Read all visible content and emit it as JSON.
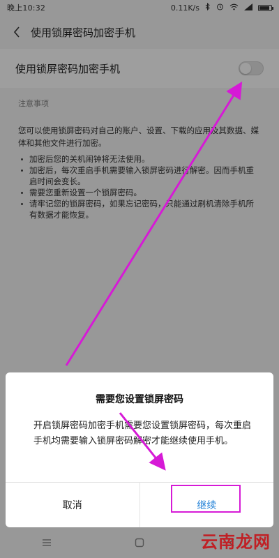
{
  "status_bar": {
    "time": "晚上10:32",
    "network_speed": "0.11K/s"
  },
  "header": {
    "title": "使用锁屏密码加密手机"
  },
  "setting": {
    "label": "使用锁屏密码加密手机",
    "enabled": false
  },
  "notes": {
    "heading": "注意事项",
    "intro": "您可以使用锁屏密码对自己的账户、设置、下载的应用及其数据、媒体和其他文件进行加密。",
    "items": [
      "加密后您的关机闹钟将无法使用。",
      "加密后，每次重启手机需要输入锁屏密码进行解密。因而手机重启时间会变长。",
      "需要您重新设置一个锁屏密码。",
      "请牢记您的锁屏密码，如果忘记密码，只能通过刷机清除手机所有数据才能恢复。"
    ]
  },
  "dialog": {
    "title": "需要您设置锁屏密码",
    "message": "开启锁屏密码加密手机需要您设置锁屏密码，每次重启手机均需要输入锁屏密码解密才能继续使用手机。",
    "cancel_label": "取消",
    "continue_label": "继续"
  },
  "watermark": {
    "text": "云南龙网"
  },
  "colors": {
    "annotation": "#d61ad6",
    "accent": "#1c7ed6",
    "watermark": "#c4161c"
  }
}
